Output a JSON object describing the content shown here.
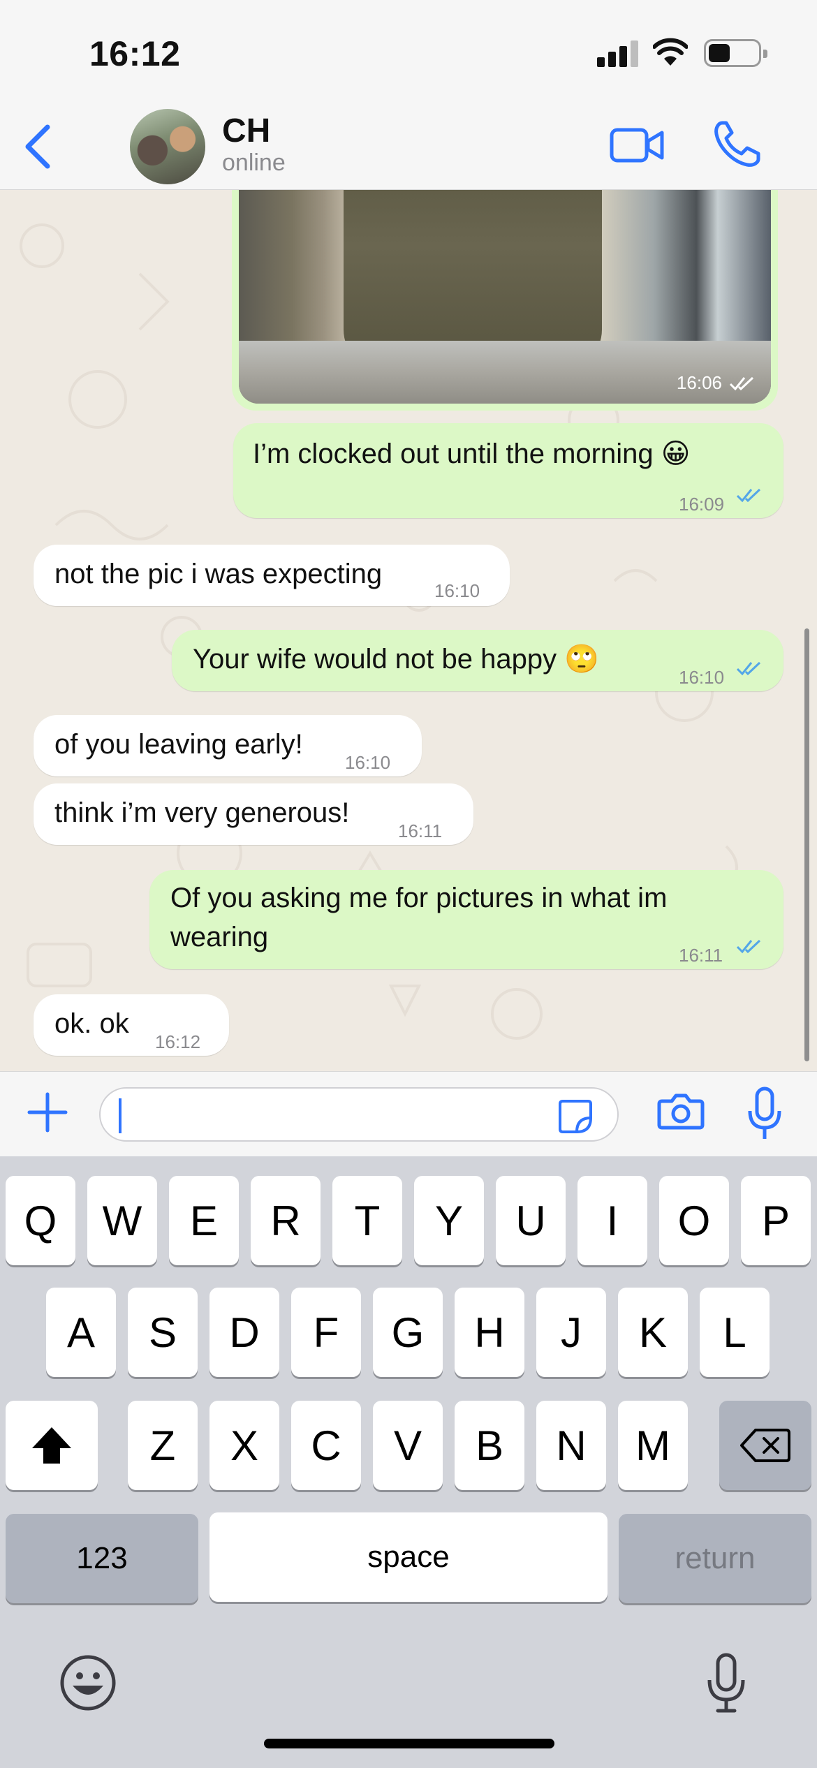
{
  "status_bar": {
    "time": "16:12"
  },
  "header": {
    "contact_name": "CH",
    "contact_status": "online"
  },
  "photo_message": {
    "time": "16:06"
  },
  "messages": [
    {
      "text": "I’m clocked out until the morning 😀",
      "time": "16:09"
    },
    {
      "text": "not the pic i was expecting",
      "time": "16:10"
    },
    {
      "text": "Your wife would not be happy 🙄",
      "time": "16:10"
    },
    {
      "text": "of you leaving early!",
      "time": "16:10"
    },
    {
      "text": "think i’m very generous!",
      "time": "16:11"
    },
    {
      "text_line1": "Of you asking me for pictures in what im",
      "text_line2": "wearing",
      "time": "16:11"
    },
    {
      "text": "ok. ok",
      "time": "16:12"
    }
  ],
  "keyboard": {
    "row1": [
      "Q",
      "W",
      "E",
      "R",
      "T",
      "Y",
      "U",
      "I",
      "O",
      "P"
    ],
    "row2": [
      "A",
      "S",
      "D",
      "F",
      "G",
      "H",
      "J",
      "K",
      "L"
    ],
    "row3": [
      "Z",
      "X",
      "C",
      "V",
      "B",
      "N",
      "M"
    ],
    "numbers_label": "123",
    "space_label": "space",
    "return_label": "return"
  },
  "colors": {
    "accent": "#2f74ff",
    "outgoing_bubble": "#dcf8c6",
    "incoming_bubble": "#ffffff",
    "read_ticks": "#53a6e8"
  }
}
